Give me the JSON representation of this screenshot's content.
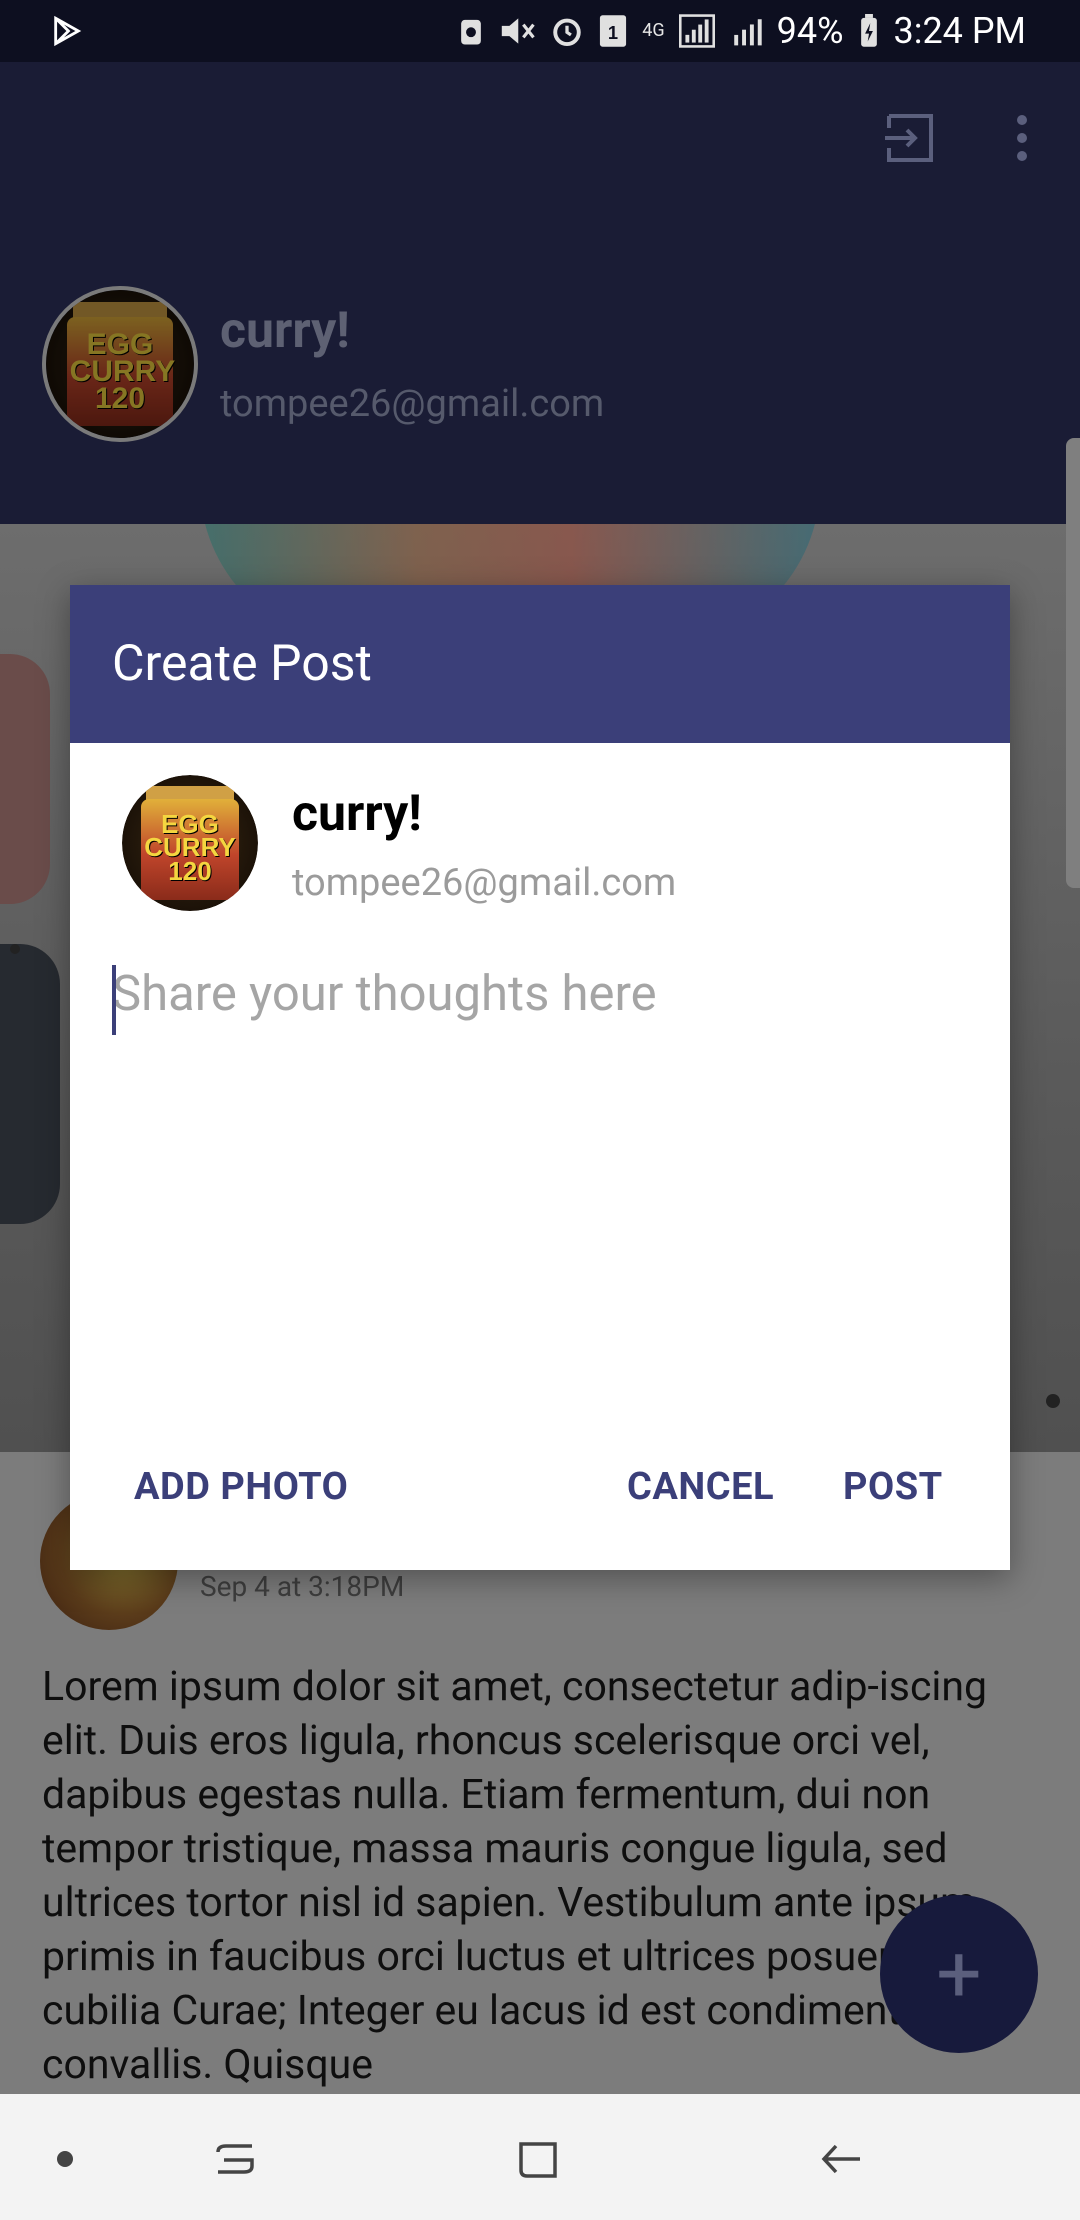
{
  "status_bar": {
    "time": "3:24 PM",
    "battery": "94%",
    "sim_slot": "1",
    "network": "4G"
  },
  "profile": {
    "name": "curry!",
    "email": "tompee26@gmail.com",
    "avatar_caption": "EGG CURRY 120"
  },
  "post": {
    "date": "Sep 4 at 3:18PM",
    "body": "Lorem ipsum dolor sit amet, consectetur adip-iscing elit. Duis eros ligula, rhoncus scelerisque orci vel, dapibus egestas nulla. Etiam fermentum, dui non tempor tristique, massa mauris congue ligula, sed ultrices tortor nisl id sapien. Vestibulum ante ipsum primis in faucibus orci luctus et ultrices posuere cubilia Curae; Integer eu lacus id est condimentum convallis. Quisque"
  },
  "dialog": {
    "title": "Create Post",
    "user_name": "curry!",
    "user_email": "tompee26@gmail.com",
    "input_placeholder": "Share your thoughts here",
    "add_photo_label": "ADD PHOTO",
    "cancel_label": "CANCEL",
    "post_label": "POST"
  },
  "fab": {
    "label": "+"
  },
  "colors": {
    "header_dark": "#1a1c35",
    "dialog_header": "#3b3f79",
    "accent_text": "#3b3f79",
    "fab": "#171a3c"
  }
}
